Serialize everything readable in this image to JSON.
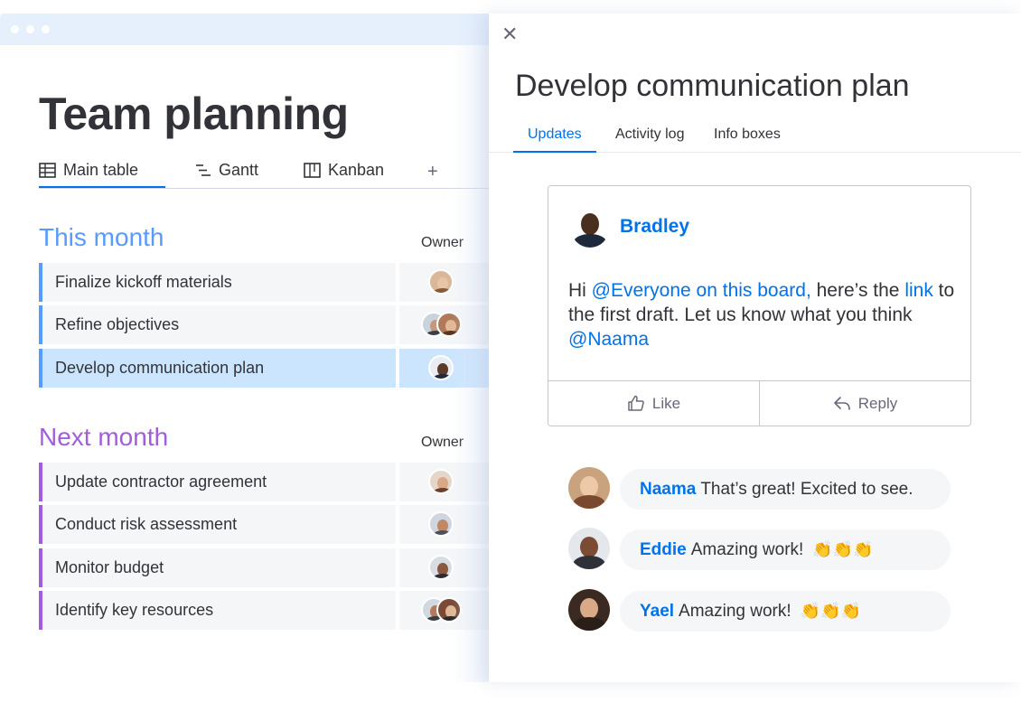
{
  "board": {
    "title": "Team planning",
    "views": [
      {
        "label": "Main table",
        "icon": "table-icon"
      },
      {
        "label": "Gantt",
        "icon": "gantt-icon"
      },
      {
        "label": "Kanban",
        "icon": "kanban-icon"
      }
    ],
    "add_view": "+",
    "groups": [
      {
        "title": "This month",
        "owner_header": "Owner",
        "color": "#579bfc",
        "items": [
          {
            "name": "Finalize kickoff materials"
          },
          {
            "name": "Refine objectives"
          },
          {
            "name": "Develop communication plan",
            "selected": true
          }
        ]
      },
      {
        "title": "Next month",
        "owner_header": "Owner",
        "color": "#a25ddc",
        "items": [
          {
            "name": "Update contractor agreement"
          },
          {
            "name": "Conduct risk assessment"
          },
          {
            "name": "Monitor budget"
          },
          {
            "name": "Identify key resources"
          }
        ]
      }
    ]
  },
  "panel": {
    "close_icon": "close-icon",
    "title": "Develop communication plan",
    "tabs": [
      "Updates",
      "Activity log",
      "Info boxes"
    ],
    "active_tab": "Updates",
    "post": {
      "author": "Bradley",
      "text_1": "Hi ",
      "mention_1": "@Everyone on this board,",
      "text_2": " here’s the ",
      "link": "link",
      "text_3": " to the first draft. Let us know what you think ",
      "mention_2": "@Naama",
      "like_label": "Like",
      "reply_label": "Reply"
    },
    "replies": [
      {
        "name": "Naama",
        "text": "That’s great! Excited to see.",
        "emoji": ""
      },
      {
        "name": "Eddie",
        "text": "Amazing work!",
        "emoji": "👏👏👏"
      },
      {
        "name": "Yael",
        "text": "Amazing work!",
        "emoji": "👏👏👏"
      }
    ]
  },
  "colors": {
    "accent": "#0073ea",
    "this_month": "#579bfc",
    "next_month": "#a25ddc",
    "selected_row": "#cce5ff"
  }
}
